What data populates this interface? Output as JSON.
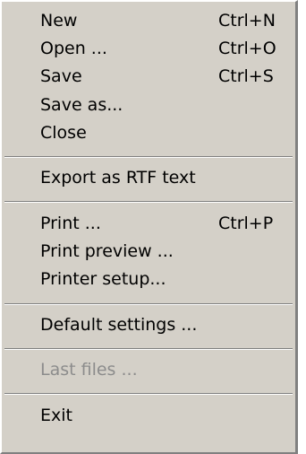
{
  "menu": {
    "new": {
      "label": "New",
      "shortcut": "Ctrl+N"
    },
    "open": {
      "label": "Open ...",
      "shortcut": "Ctrl+O"
    },
    "save": {
      "label": "Save",
      "shortcut": "Ctrl+S"
    },
    "save_as": {
      "label": "Save as..."
    },
    "close": {
      "label": "Close"
    },
    "export_rtf": {
      "label": "Export as RTF text"
    },
    "print": {
      "label": "Print ...",
      "shortcut": "Ctrl+P"
    },
    "print_preview": {
      "label": "Print preview ..."
    },
    "printer_setup": {
      "label": "Printer setup..."
    },
    "default_settings": {
      "label": "Default settings ..."
    },
    "last_files": {
      "label": "Last files ...",
      "disabled": true
    },
    "exit": {
      "label": "Exit"
    }
  }
}
